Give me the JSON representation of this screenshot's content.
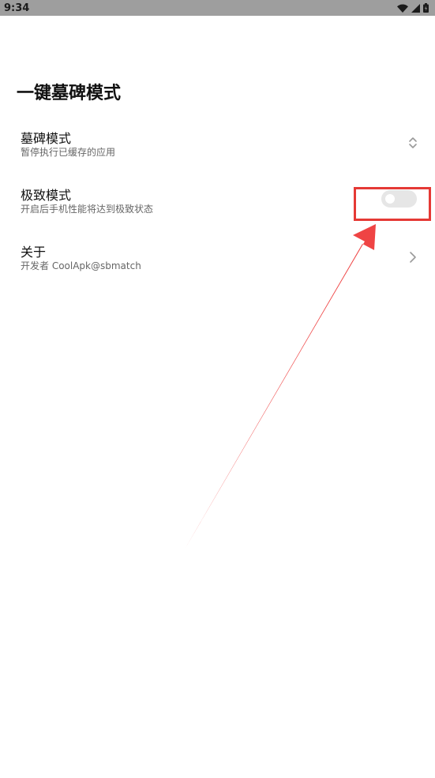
{
  "status_bar": {
    "time": "9:34"
  },
  "page": {
    "title": "一键墓碑模式"
  },
  "settings": [
    {
      "title": "墓碑模式",
      "subtitle": "暂停执行已缓存的应用",
      "control": "up-down-selector"
    },
    {
      "title": "极致模式",
      "subtitle": "开启后手机性能将达到极致状态",
      "control": "toggle",
      "toggle_on": false
    },
    {
      "title": "关于",
      "subtitle": "开发者 CoolApk@sbmatch",
      "control": "chevron-right"
    }
  ],
  "icons": {
    "status": [
      "wifi-icon",
      "signal-icon",
      "battery-icon"
    ],
    "row_1": "chevron-up-down-icon",
    "row_3": "chevron-right-icon"
  },
  "colors": {
    "status_bar": "#9e9e9e",
    "highlight": "#e53935",
    "toggle_off": "#e6e6e6",
    "subtitle": "#666666"
  }
}
